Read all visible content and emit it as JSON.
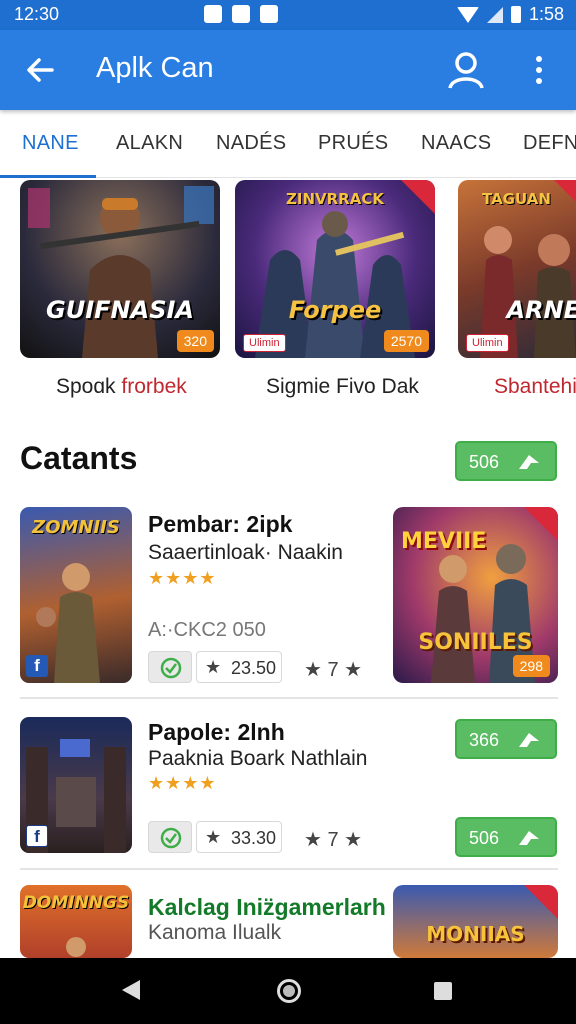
{
  "status_bar": {
    "time_left": "12:30",
    "time_right": "1:58"
  },
  "app_bar": {
    "title": "Aplk Can"
  },
  "tabs": [
    {
      "label": "NANE",
      "active": true
    },
    {
      "label": "ALAKN",
      "active": false
    },
    {
      "label": "NADÉS",
      "active": false
    },
    {
      "label": "PRUÉS",
      "active": false
    },
    {
      "label": "NAACS",
      "active": false
    },
    {
      "label": "DEFNA",
      "active": false
    }
  ],
  "featured": [
    {
      "art_title": "GUIFNASIA",
      "art_top": "",
      "price": "320",
      "label_plain": "Spoɑk ",
      "label_red": "frorbek"
    },
    {
      "art_title": "Forpee",
      "art_top": "ZINVRRACK",
      "price": "2570",
      "pill": "Ulimin",
      "label_plain": "Sigmie Fivo Dak",
      "label_red": ""
    },
    {
      "art_title": "ARNE",
      "art_top": "TAGUAN",
      "price": "",
      "pill": "Ulimin",
      "label_plain": "",
      "label_red": "Sbantehi"
    }
  ],
  "section": {
    "title": "Catants",
    "button_value": "506"
  },
  "list": [
    {
      "thumb_text": "ZOMNIIS",
      "title": "Pembar: 2ipk",
      "subtitle": "Saaertinloak· Naakin",
      "stars": "★★★★",
      "meta": "A:·CKC2 050",
      "rating": "23.50",
      "rank": "★ 7 ★",
      "right_top": "MEVIIE",
      "right_title": "SONIILES",
      "right_price": "298"
    },
    {
      "title": "Papole: 2lnh",
      "subtitle": "Paaknia Boark Nathlain",
      "stars": "★★★★",
      "rating": "33.30",
      "rank": "★ 7 ★",
      "button_top": "366",
      "button_bottom": "506"
    },
    {
      "thumb_text": "DOMINNGS",
      "title": "Kalclag Iniz̈gamerlarh",
      "subtitle": "Kanoma Ilualk",
      "right_title": "MONIIAS"
    }
  ],
  "colors": {
    "primary": "#2a7de1",
    "status_bar": "#1f6fd0",
    "green": "#5bbd63",
    "price_orange": "#f08a1c",
    "red": "#c0282f"
  }
}
